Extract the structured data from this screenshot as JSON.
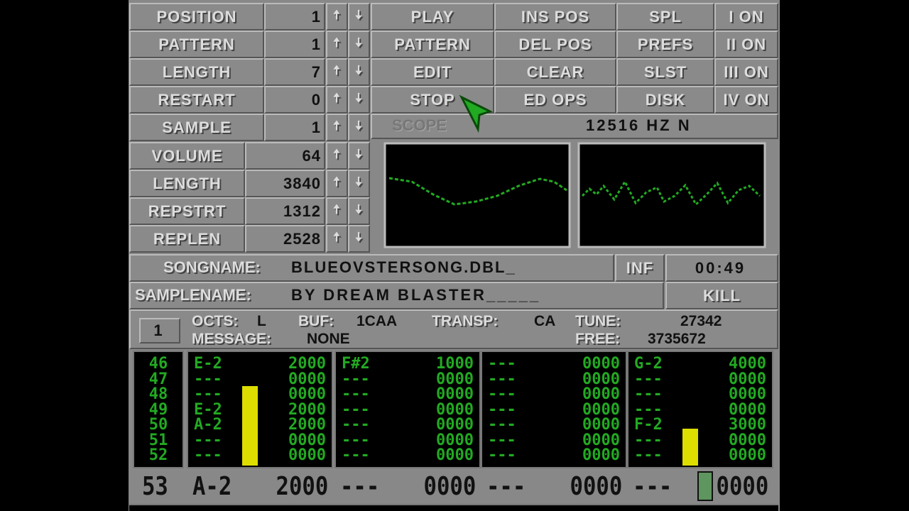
{
  "controls": [
    {
      "label": "POSITION",
      "value": "1"
    },
    {
      "label": "PATTERN",
      "value": "1"
    },
    {
      "label": "LENGTH",
      "value": "7"
    },
    {
      "label": "RESTART",
      "value": "0"
    },
    {
      "label": "SAMPLE",
      "value": "1"
    }
  ],
  "sample_controls": [
    {
      "label": "VOLUME",
      "value": "64"
    },
    {
      "label": "LENGTH",
      "value": "3840"
    },
    {
      "label": "REPSTRT",
      "value": "1312"
    },
    {
      "label": "REPLEN",
      "value": "2528"
    }
  ],
  "arrows": {
    "up": "🠅",
    "down": "🠇"
  },
  "buttons": {
    "col1": [
      "PLAY",
      "PATTERN",
      "EDIT",
      "STOP"
    ],
    "col2": [
      "INS POS",
      "DEL POS",
      "CLEAR",
      "ED OPS"
    ],
    "col3": [
      "SPL",
      "PREFS",
      "SLST",
      "DISK"
    ],
    "channels": [
      "I ON",
      "II ON",
      "III ON",
      "IV ON"
    ]
  },
  "scope": {
    "label": "SCOPE",
    "freq": "12516 HZ  N"
  },
  "song": {
    "label": "SONGNAME:",
    "name": "BLUEOVSTERSONG.DBL_",
    "inf": "INF",
    "time": "00:49"
  },
  "samplename": {
    "label": "SAMPLENAME:",
    "name": "BY DREAM BLASTER_____",
    "kill": "KILL"
  },
  "info": {
    "channel_num": "1",
    "octs_label": "OCTS:",
    "octs": "L",
    "buf_label": "BUF:",
    "buf": "1CAA",
    "transp_label": "TRANSP:",
    "transp": "CA",
    "tune_label": "TUNE:",
    "tune": "27342",
    "message_label": "MESSAGE:",
    "message": "NONE",
    "free_label": "FREE:",
    "free": "3735672"
  },
  "pattern": {
    "rows": [
      "46",
      "47",
      "48",
      "49",
      "50",
      "51",
      "52"
    ],
    "channels": [
      [
        [
          "E-2",
          "2000"
        ],
        [
          "---",
          "0000"
        ],
        [
          "---",
          "0000"
        ],
        [
          "E-2",
          "2000"
        ],
        [
          "A-2",
          "2000"
        ],
        [
          "---",
          "0000"
        ],
        [
          "---",
          "0000"
        ]
      ],
      [
        [
          "F#2",
          "1000"
        ],
        [
          "---",
          "0000"
        ],
        [
          "---",
          "0000"
        ],
        [
          "---",
          "0000"
        ],
        [
          "---",
          "0000"
        ],
        [
          "---",
          "0000"
        ],
        [
          "---",
          "0000"
        ]
      ],
      [
        [
          "---",
          "0000"
        ],
        [
          "---",
          "0000"
        ],
        [
          "---",
          "0000"
        ],
        [
          "---",
          "0000"
        ],
        [
          "---",
          "0000"
        ],
        [
          "---",
          "0000"
        ],
        [
          "---",
          "0000"
        ]
      ],
      [
        [
          "G-2",
          "4000"
        ],
        [
          "---",
          "0000"
        ],
        [
          "---",
          "0000"
        ],
        [
          "---",
          "0000"
        ],
        [
          "F-2",
          "3000"
        ],
        [
          "---",
          "0000"
        ],
        [
          "---",
          "0000"
        ]
      ]
    ],
    "vu_levels": [
      0.75,
      0,
      0,
      0.35
    ],
    "current": {
      "row": "53",
      "cells": [
        [
          "A-2",
          "2000"
        ],
        [
          "---",
          "0000"
        ],
        [
          "---",
          "0000"
        ],
        [
          "---",
          "0000"
        ]
      ]
    }
  },
  "colors": {
    "pattern_text": "#22aa22",
    "vu": "#dddd00",
    "cursor": "#22aa22"
  }
}
